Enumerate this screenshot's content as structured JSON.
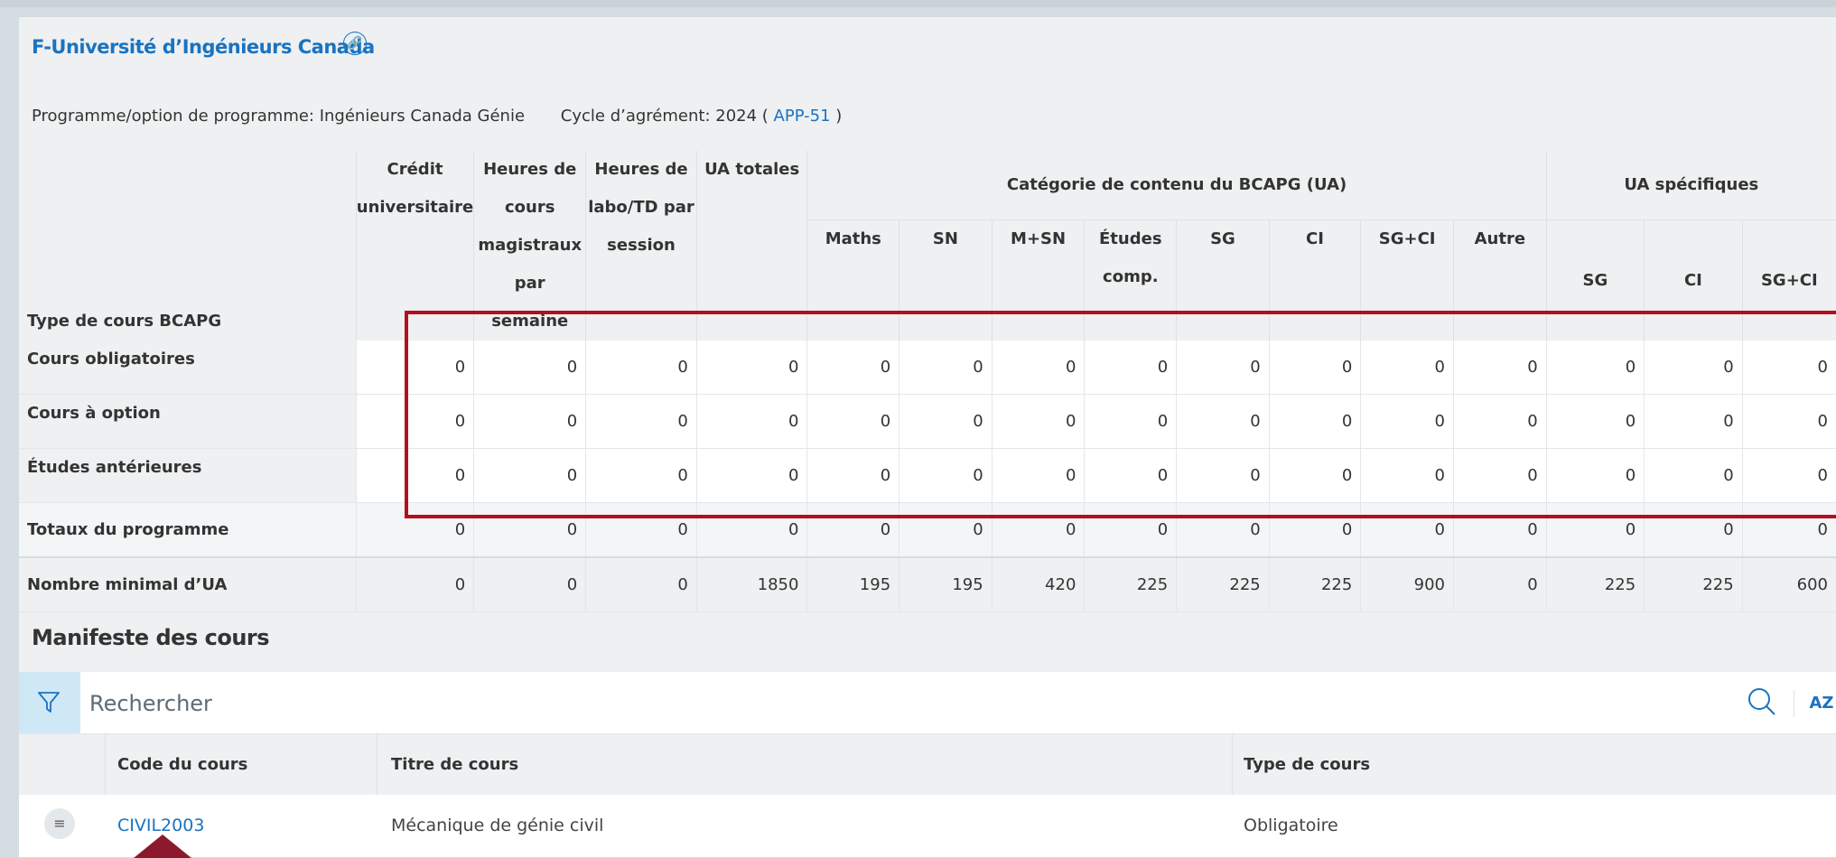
{
  "header": {
    "title": "F-Université d’Ingénieurs Canada",
    "program_label": "Programme/option de programme: Ingénieurs Canada Génie",
    "cycle_label": "Cycle d’agrément: 2024 (",
    "cycle_link": "APP-51",
    "cycle_close": ")"
  },
  "summary_table": {
    "col_type": "Type de cours BCAPG",
    "col_credit": "Crédit universitaire",
    "col_lecture": "Heures de cours magistraux par semaine",
    "col_lab": "Heures de labo/TD par session",
    "col_total": "UA totales",
    "group_category": "Catégorie de contenu du BCAPG (UA)",
    "group_specific": "UA spécifiques",
    "category_cols": [
      "Maths",
      "SN",
      "M+SN",
      "Études comp.",
      "SG",
      "CI",
      "SG+CI",
      "Autre"
    ],
    "specific_cols": [
      "SG",
      "CI",
      "SG+CI"
    ],
    "rows": [
      {
        "label": "Cours obligatoires",
        "values": [
          "0",
          "0",
          "0",
          "0",
          "0",
          "0",
          "0",
          "0",
          "0",
          "0",
          "0",
          "0",
          "0",
          "0",
          "0"
        ]
      },
      {
        "label": "Cours à option",
        "values": [
          "0",
          "0",
          "0",
          "0",
          "0",
          "0",
          "0",
          "0",
          "0",
          "0",
          "0",
          "0",
          "0",
          "0",
          "0"
        ]
      },
      {
        "label": "Études antérieures",
        "values": [
          "0",
          "0",
          "0",
          "0",
          "0",
          "0",
          "0",
          "0",
          "0",
          "0",
          "0",
          "0",
          "0",
          "0",
          "0"
        ]
      },
      {
        "label": "Totaux du programme",
        "values": [
          "0",
          "0",
          "0",
          "0",
          "0",
          "0",
          "0",
          "0",
          "0",
          "0",
          "0",
          "0",
          "0",
          "0",
          "0"
        ]
      },
      {
        "label": "Nombre minimal d’UA",
        "values": [
          "0",
          "0",
          "0",
          "1850",
          "195",
          "195",
          "420",
          "225",
          "225",
          "225",
          "900",
          "0",
          "225",
          "225",
          "600"
        ]
      }
    ]
  },
  "manifest": {
    "title": "Manifeste des cours",
    "search_placeholder": "Rechercher",
    "sort_label": "AZ",
    "col_code": "Code du cours",
    "col_title": "Titre de cours",
    "col_type": "Type de cours",
    "courses": [
      {
        "code": "CIVIL2003",
        "title": "Mécanique de génie civil",
        "type": "Obligatoire"
      }
    ]
  },
  "colors": {
    "link": "#1a73c0",
    "highlight": "#b40f1e",
    "arrow": "#8a1a2c"
  }
}
